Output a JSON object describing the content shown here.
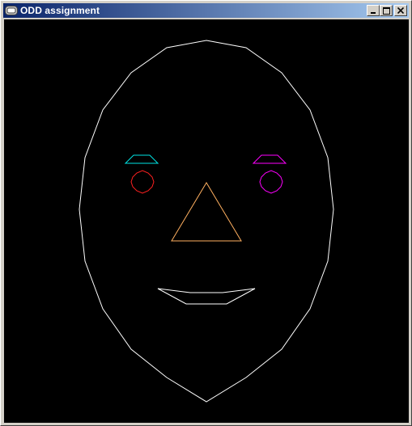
{
  "window": {
    "title": "ODD assignment",
    "app_icon": "opengl-window-icon",
    "controls": {
      "minimize_icon": "minimize-icon",
      "maximize_icon": "maximize-icon",
      "close_icon": "close-icon"
    }
  },
  "drawing": {
    "background": "#000000",
    "face_outline_color": "#ffffff",
    "left_eyebrow_color": "#00e5e5",
    "right_eyebrow_color": "#ff00ff",
    "left_eye_color": "#ff2020",
    "right_eye_color": "#ff00ff",
    "nose_color": "#ffb060",
    "mouth_color": "#ffffff"
  }
}
